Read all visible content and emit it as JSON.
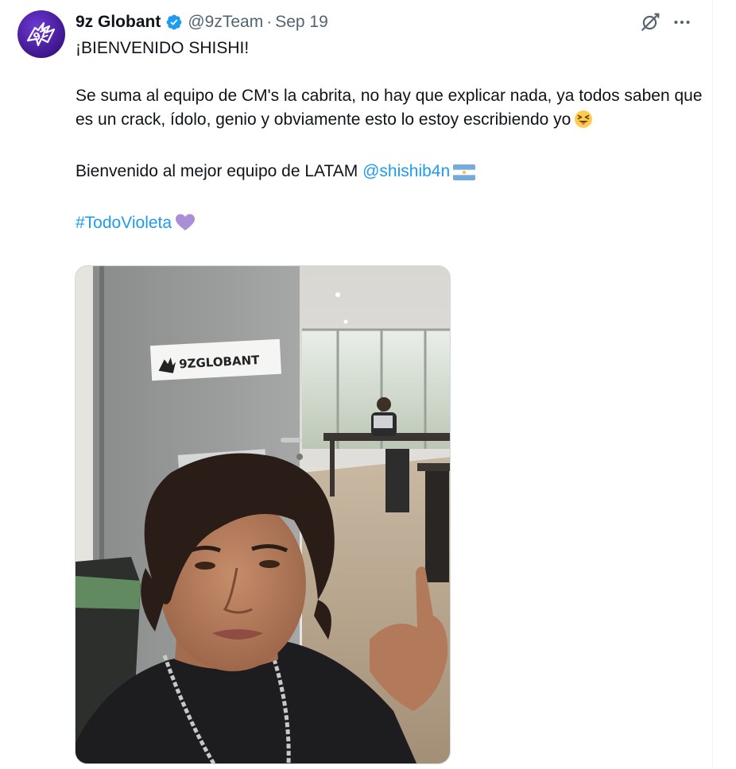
{
  "tweet": {
    "display_name": "9z Globant",
    "handle": "@9zTeam",
    "separator": "·",
    "date": "Sep 19",
    "line1": "¡BIENVENIDO SHISHI!",
    "line2": "Se suma al equipo de CM's la cabrita, no hay que explicar nada, ya todos saben que es un crack, ídolo, genio y obviamente esto lo estoy escribiendo yo",
    "line3": "Bienvenido al mejor equipo de LATAM",
    "mention": "@shishib4n",
    "hashtag": "#TodoVioleta",
    "photo_sign_text": "9ZGLOBANT"
  },
  "icons": {
    "verified": "verified-badge-icon",
    "grok": "grok-icon",
    "more": "more-options-icon",
    "emoji_tongue": "squinting-face-with-tongue-emoji",
    "flag": "argentina-flag-emoji",
    "heart": "purple-heart-emoji"
  },
  "colors": {
    "link": "#1d9bf0",
    "secondary_text": "#536471",
    "verified": "#1d9bf0",
    "brand_purple": "#5b2cc7"
  }
}
